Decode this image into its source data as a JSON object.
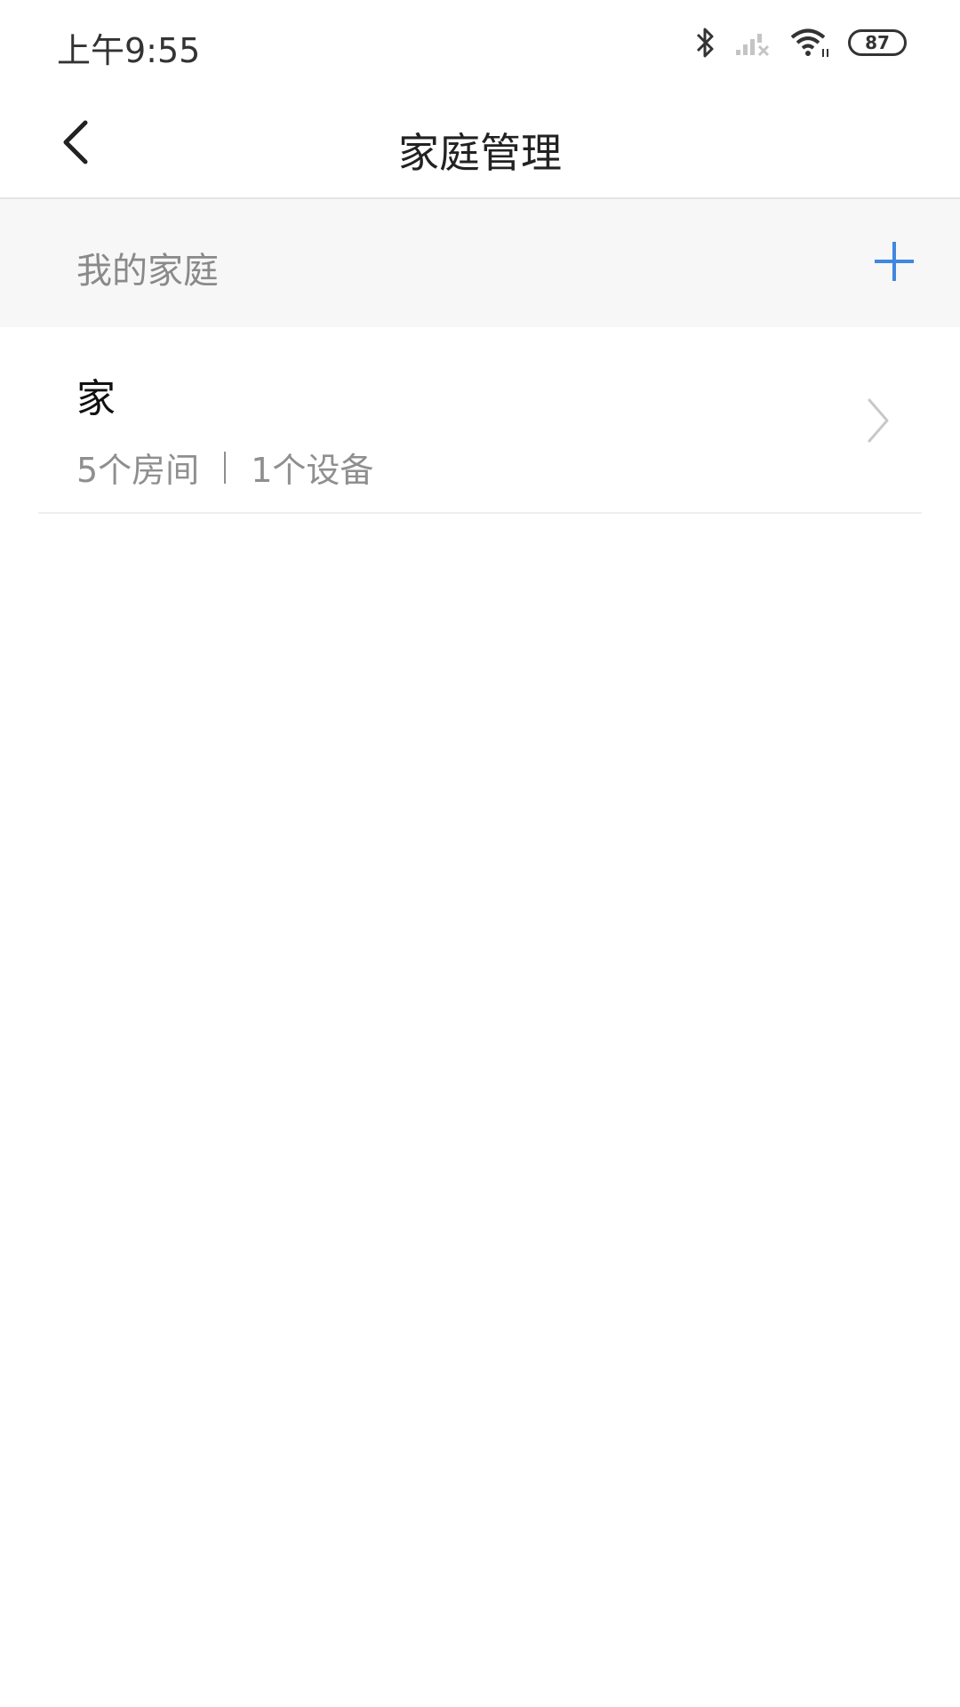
{
  "status_bar": {
    "time": "上午9:55",
    "battery_level": "87",
    "icons": [
      "bluetooth-icon",
      "signal-icon",
      "wifi-icon",
      "battery-icon"
    ]
  },
  "header": {
    "title": "家庭管理",
    "back_icon": "chevron-left-icon"
  },
  "section": {
    "title": "我的家庭",
    "add_icon": "plus-icon",
    "accent_color": "#3f87e0"
  },
  "families": [
    {
      "name": "家",
      "rooms": "5个房间",
      "devices": "1个设备"
    }
  ]
}
